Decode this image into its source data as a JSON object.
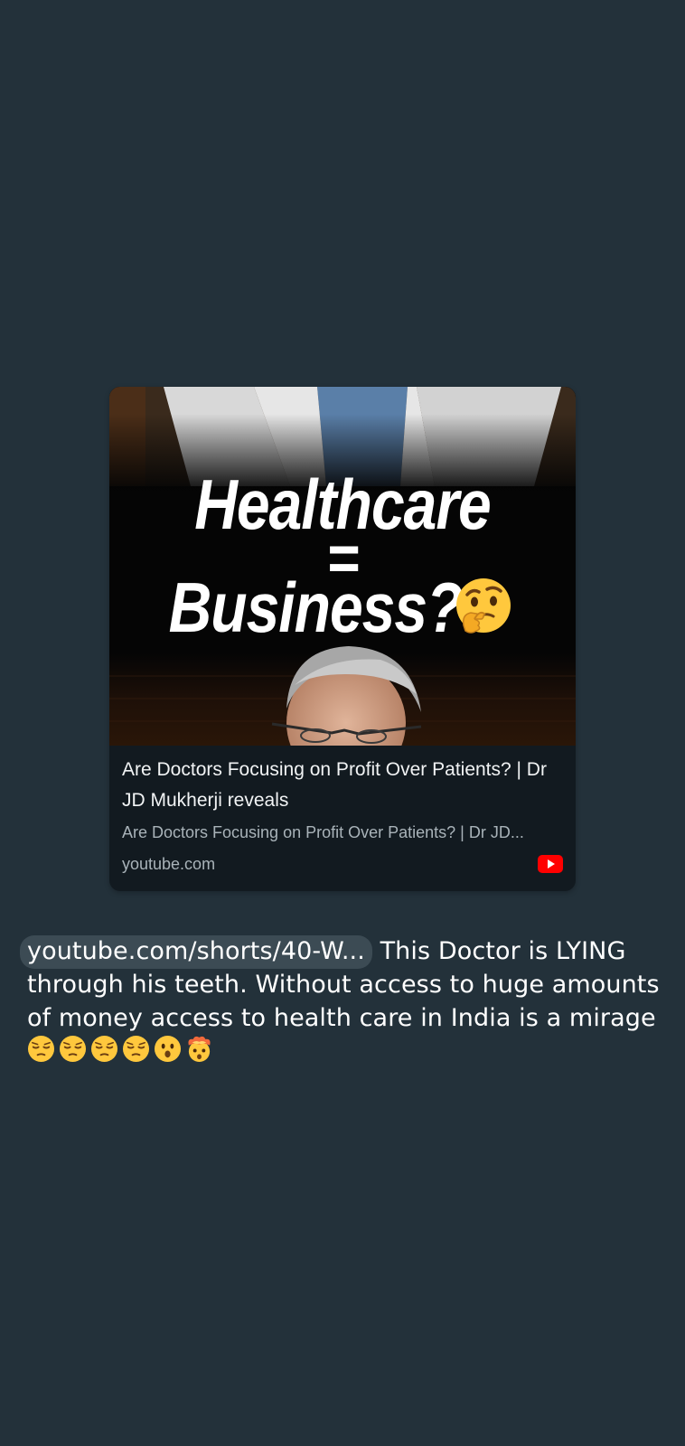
{
  "link_preview": {
    "thumbnail": {
      "headline_line1": "Healthcare",
      "headline_line2": "=",
      "headline_line3": "Business?",
      "emoji_icon": "thinking-face-icon"
    },
    "title": "Are Doctors Focusing on Profit Over Patients? | Dr JD Mukherji reveals",
    "description": "Are Doctors Focusing on Profit Over Patients? | Dr JD...",
    "domain": "youtube.com",
    "site_icon": "youtube-icon"
  },
  "caption": {
    "link_text": "youtube.com/shorts/40-W...",
    "text": " This Doctor is LYING through his teeth. Without access to huge amounts of money access to health care in India is a mirage ",
    "emojis": [
      "pensive-face-icon",
      "pensive-face-icon",
      "pensive-face-icon",
      "pensive-face-icon",
      "hushed-face-icon",
      "exploding-head-icon"
    ]
  },
  "colors": {
    "background": "#23313a",
    "card": "#121a20",
    "link_chip": "#3c4b54",
    "youtube_red": "#ff0000"
  }
}
